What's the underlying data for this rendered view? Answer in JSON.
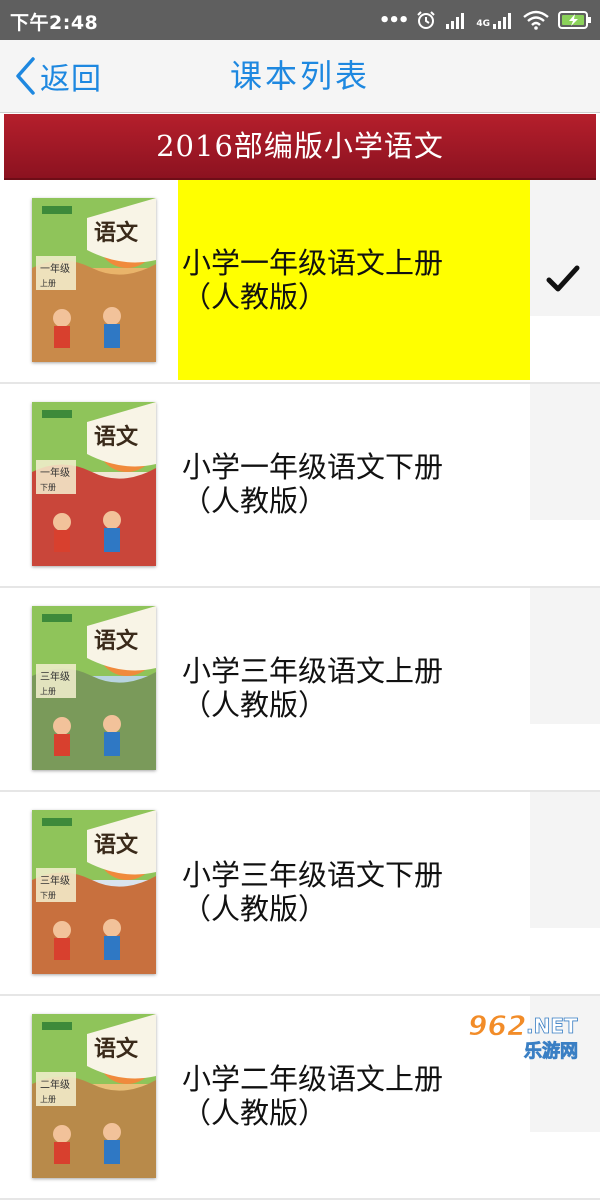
{
  "status_bar": {
    "time": "下午2:48",
    "network_label": "4G",
    "icons": [
      "more-dots-icon",
      "alarm-icon",
      "signal-icon",
      "signal-4g-icon",
      "wifi-icon",
      "battery-charging-icon"
    ]
  },
  "nav": {
    "back_label": "返回",
    "title": "课本列表"
  },
  "section": {
    "title": "2016部编版小学语文"
  },
  "books": [
    {
      "title": "小学一年级语文上册",
      "edition": "（人教版）",
      "selected": true,
      "cover_grade": "一年级",
      "cover_term": "上册"
    },
    {
      "title": "小学一年级语文下册",
      "edition": "（人教版）",
      "selected": false,
      "cover_grade": "一年级",
      "cover_term": "下册"
    },
    {
      "title": "小学三年级语文上册",
      "edition": "（人教版）",
      "selected": false,
      "cover_grade": "三年级",
      "cover_term": "上册"
    },
    {
      "title": "小学三年级语文下册",
      "edition": "（人教版）",
      "selected": false,
      "cover_grade": "三年级",
      "cover_term": "下册"
    },
    {
      "title": "小学二年级语文上册",
      "edition": "（人教版）",
      "selected": false,
      "cover_grade": "二年级",
      "cover_term": "上册"
    }
  ],
  "cover_subject": "语文",
  "watermark": {
    "number": "962",
    "suffix": ".NET",
    "site": "乐游网"
  },
  "colors": {
    "accent": "#1e88e0",
    "section_bg": "#a01826",
    "highlight": "#ffff00"
  }
}
